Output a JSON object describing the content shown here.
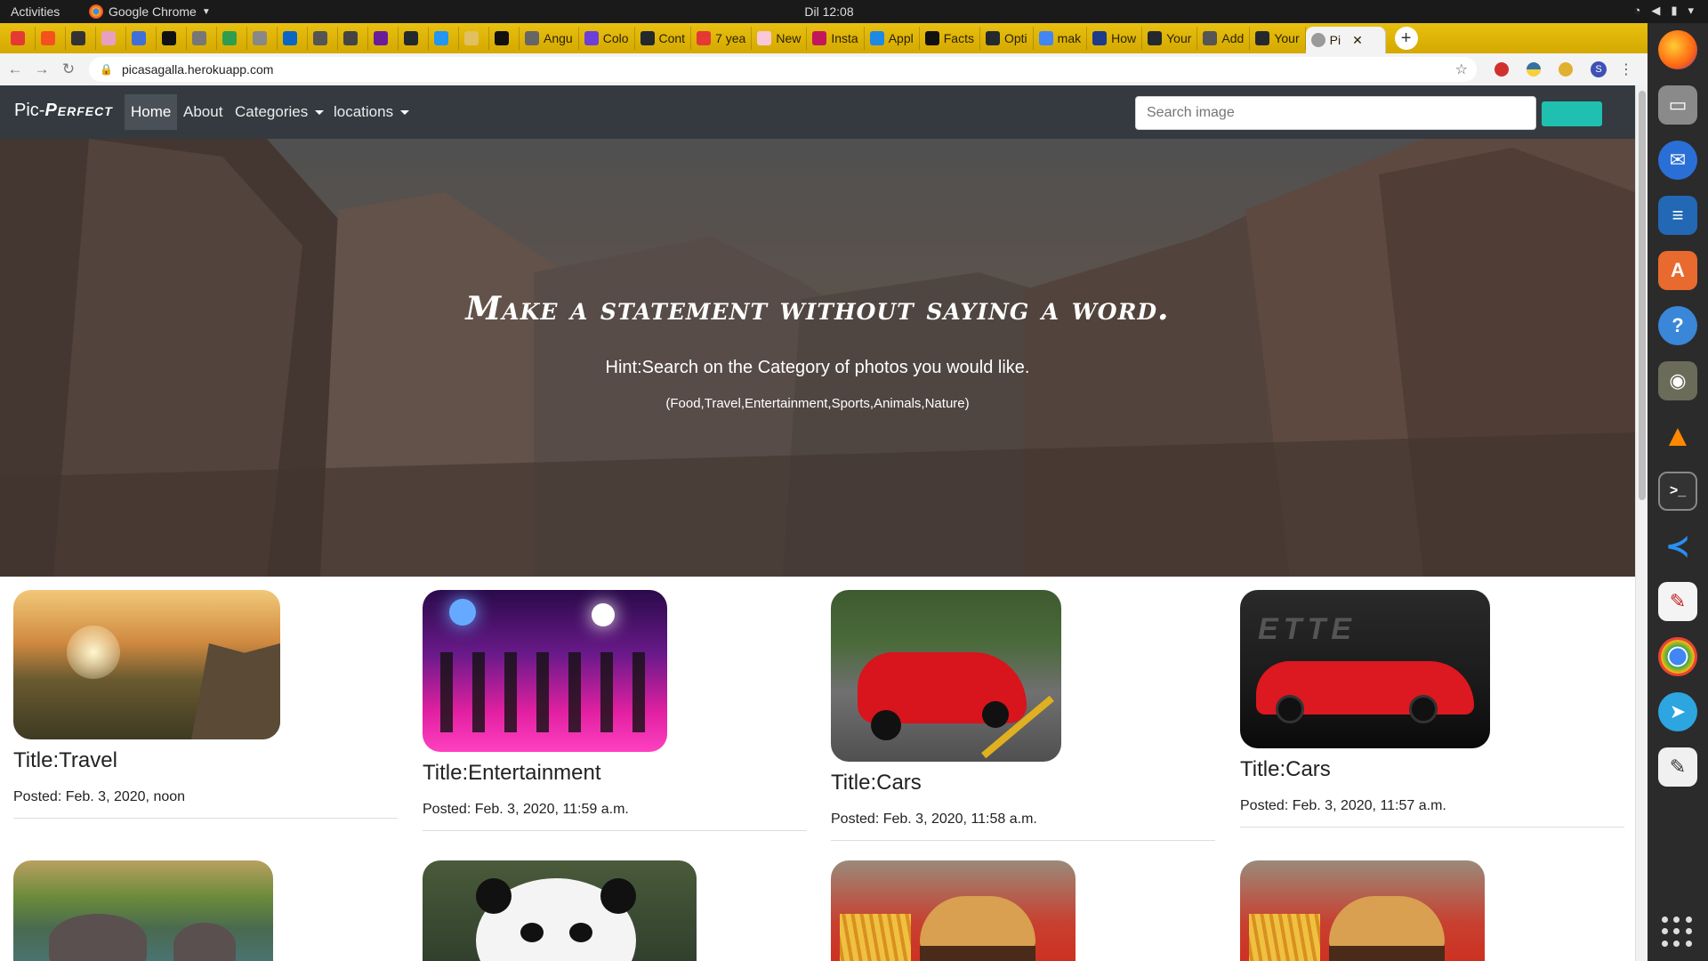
{
  "system": {
    "activities": "Activities",
    "app_name": "Google Chrome",
    "clock": "Dil 12:08"
  },
  "browser": {
    "tabs": [
      "",
      "",
      "",
      "",
      "",
      "",
      "",
      "",
      "",
      "",
      "",
      "",
      "",
      "",
      "",
      "",
      "",
      "Angu",
      "Colo",
      "Cont",
      "7 yea",
      "New",
      "Insta",
      "Appl",
      "Facts",
      "Opti",
      "mak",
      "How",
      "Your",
      "Add",
      "Your"
    ],
    "active_tab": "Pi",
    "url": "picasagalla.herokuapp.com"
  },
  "site": {
    "brand_prefix": "Pic-",
    "brand_suffix": "Perfect",
    "nav": {
      "home": "Home",
      "about": "About",
      "categories": "Categories",
      "locations": "locations"
    },
    "search": {
      "placeholder": "Search image"
    }
  },
  "hero": {
    "heading": "Make a statement without saying a word.",
    "hint": "Hint:Search on the Category of photos you would like.",
    "categories": "(Food,Travel,Entertainment,Sports,Animals,Nature)"
  },
  "cards": [
    {
      "title": "Title:Travel",
      "posted": "Posted: Feb. 3, 2020, noon",
      "image": "travel"
    },
    {
      "title": "Title:Entertainment",
      "posted": "Posted: Feb. 3, 2020, 11:59 a.m.",
      "image": "entertainment"
    },
    {
      "title": "Title:Cars",
      "posted": "Posted: Feb. 3, 2020, 11:58 a.m.",
      "image": "mustang"
    },
    {
      "title": "Title:Cars",
      "posted": "Posted: Feb. 3, 2020, 11:57 a.m.",
      "image": "corvette"
    }
  ],
  "colors": {
    "navbar": "#343a40",
    "search_button": "#20c0b0",
    "tab_strip": "#e0b800"
  }
}
